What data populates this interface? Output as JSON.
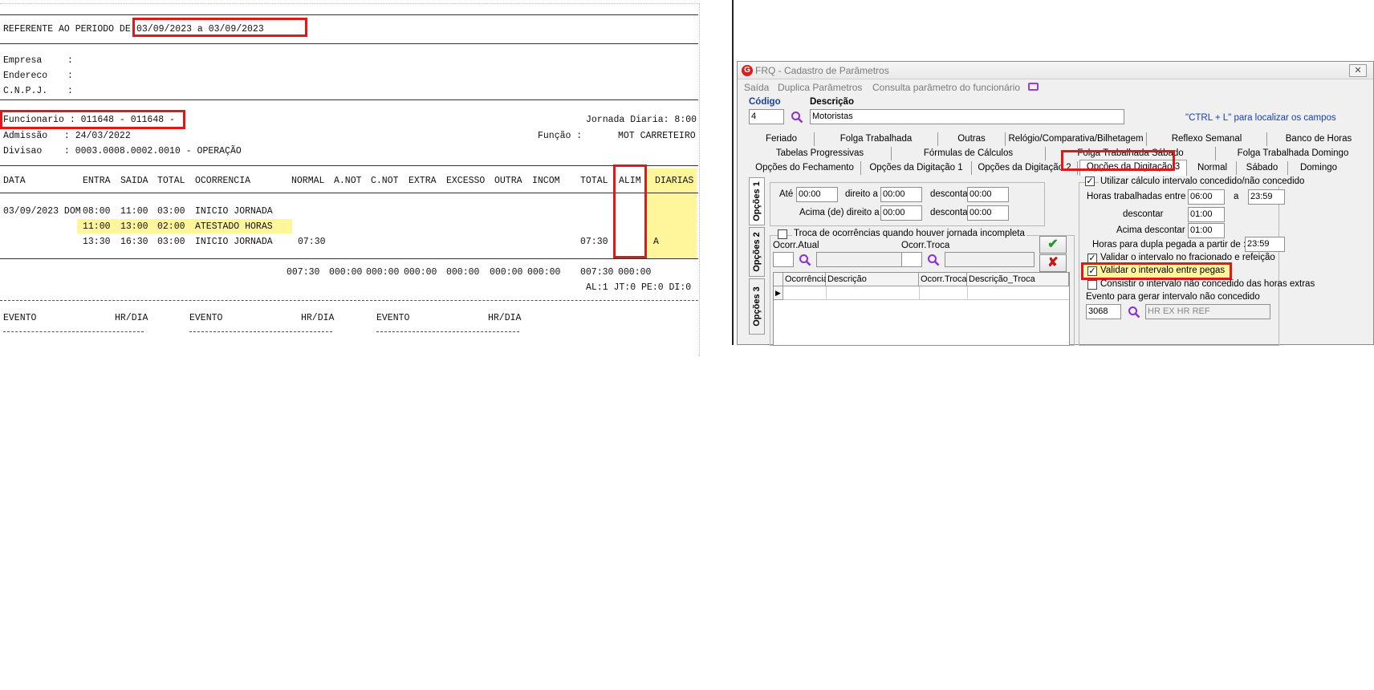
{
  "report": {
    "periodo_label": "REFERENTE AO PERIODO DE:",
    "periodo_value": "03/09/2023 a 03/09/2023",
    "empresa_label": "Empresa",
    "endereco_label": "Endereco",
    "cnpj_label": "C.N.P.J.",
    "colon": ":",
    "funcionario": "Funcionario : 011648 - 011648 -",
    "jornada_diaria": "Jornada Diaria: 8:00",
    "admissao": "Admissão   : 24/03/2022",
    "funcao_label": "Função :",
    "funcao_value": "MOT CARRETEIRO",
    "divisao": "Divisao    : 0003.0008.0002.0010 - OPERAÇÃO",
    "headers": [
      "DATA",
      "ENTRA",
      "SAIDA",
      "TOTAL",
      "OCORRENCIA",
      "NORMAL",
      "A.NOT",
      "C.NOT",
      "EXTRA",
      "EXCESSO",
      "OUTRA",
      "INCOM",
      "TOTAL",
      "ALIM",
      "DIARIAS"
    ],
    "row1": {
      "data": "03/09/2023 DOM",
      "entra": "08:00",
      "saida": "11:00",
      "total": "03:00",
      "ocorrencia": "INICIO JORNADA"
    },
    "row2": {
      "entra": "11:00",
      "saida": "13:00",
      "total": "02:00",
      "ocorrencia": "ATESTADO HORAS"
    },
    "row3": {
      "entra": "13:30",
      "saida": "16:30",
      "total": "03:00",
      "ocorrencia": "INICIO JORNADA",
      "normal": "07:30",
      "total2": "07:30",
      "diarias": "A"
    },
    "totals": [
      "007:30",
      "000:00",
      "000:00",
      "000:00",
      "000:00",
      "000:00",
      "000:00",
      "007:30",
      "000:00"
    ],
    "summary": "AL:1 JT:0 PE:0 DI:0",
    "evento_headers": [
      "EVENTO",
      "HR/DIA",
      "EVENTO",
      "HR/DIA",
      "EVENTO",
      "HR/DIA"
    ]
  },
  "window": {
    "title": "FRQ - Cadastro de Parâmetros",
    "close": "✕",
    "menu": [
      "Saída",
      "Duplica Parâmetros",
      "Consulta parâmetro do funcionário"
    ],
    "codigo_label": "Código",
    "codigo_value": "4",
    "descricao_label": "Descrição",
    "descricao_value": "Motoristas",
    "hint": "\"CTRL + L\" para localizar os campos",
    "tabs_row1": [
      "Feriado",
      "Folga Trabalhada",
      "Outras",
      "Relógio/Comparativa/Bilhetagem",
      "Reflexo Semanal",
      "Banco de Horas"
    ],
    "tabs_row2": [
      "Tabelas Progressivas",
      "Fórmulas de Cálculos",
      "Folga Trabalhada Sábado",
      "Folga Trabalhada Domingo"
    ],
    "tabs_row3": [
      "Opções do Fechamento",
      "Opções da Digitação 1",
      "Opções da Digitação 2",
      "Opções da Digitação 3",
      "Normal",
      "Sábado",
      "Domingo"
    ],
    "vtabs": [
      "Opções 1",
      "Opções 2",
      "Opções 3"
    ],
    "ate_label": "Até",
    "ate_value": "00:00",
    "direito_a_label": "direito a",
    "direito_a_value": "00:00",
    "descontar_label": "descontar",
    "descontar_value": "00:00",
    "acima_label": "Acima (de) direito a",
    "acima_value": "00:00",
    "descontar2_label": "descontar",
    "descontar2_value": "00:00",
    "troca_label": "Troca de ocorrências quando houver jornada incompleta",
    "ocorr_atual_label": "Ocorr.Atual",
    "ocorr_troca_label": "Ocorr.Troca",
    "grid_headers": [
      "Ocorrência",
      "Descrição",
      "Ocorr.Troca",
      "Descrição_Troca"
    ],
    "utilizar_label": "Utilizar cálculo intervalo concedido/não concedido",
    "horas_trab_label": "Horas trabalhadas entre :",
    "horas_trab_from": "06:00",
    "a_label": "a",
    "horas_trab_to": "23:59",
    "descontar3_label": "descontar",
    "descontar3_value": "01:00",
    "acima_descontar_label": "Acima descontar :",
    "acima_descontar_value": "01:00",
    "dupla_label": "Horas para dupla pegada a partir de :",
    "dupla_value": "23:59",
    "validar_frac_label": "Validar o intervalo no fracionado e refeição",
    "validar_pegas_label": "Validar o intervalo entre pegas",
    "consistir_label": "Consistir o intervalo não concedido das horas extras",
    "evento_label": "Evento para gerar intervalo não concedido",
    "evento_code": "3068",
    "evento_desc": "HR EX HR REF"
  },
  "colors": {
    "highlight": "#fff59a",
    "redbox": "#e01818",
    "link": "#1a3fa8",
    "ok": "#1f9a2b",
    "cancel": "#c2181a"
  }
}
